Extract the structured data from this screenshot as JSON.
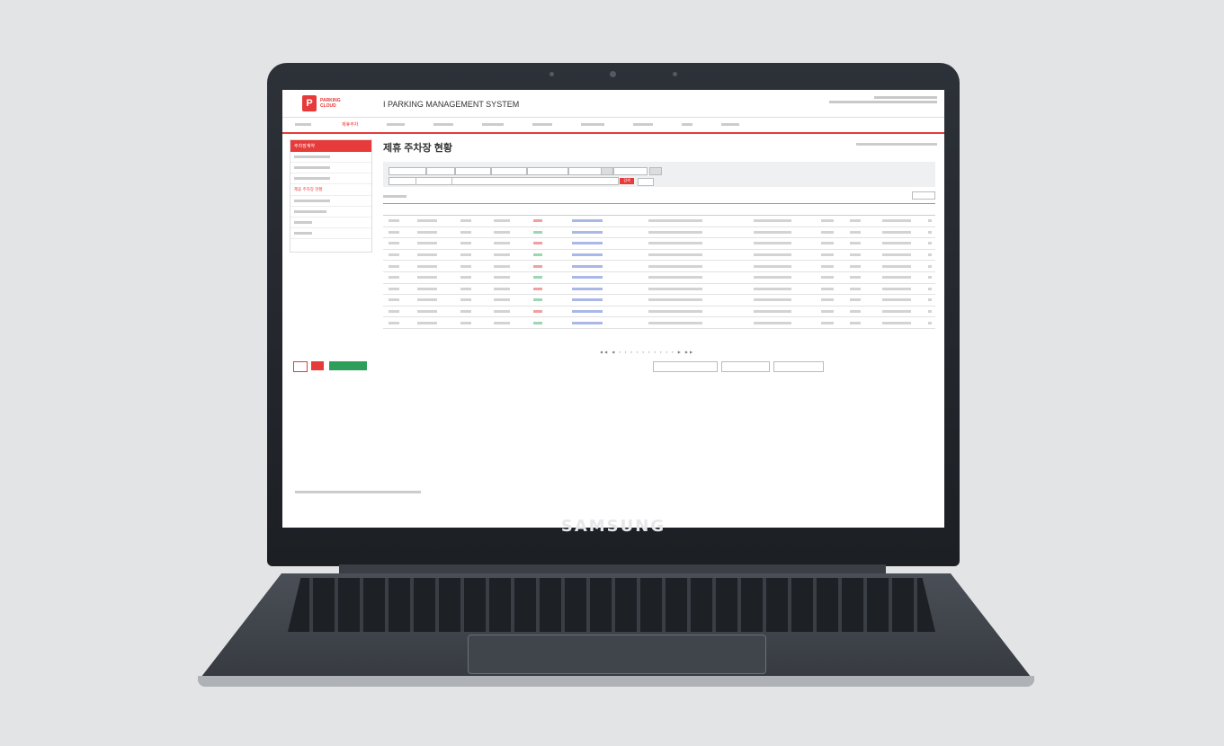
{
  "device": {
    "brand": "SAMSUNG"
  },
  "logo": {
    "mark": "P",
    "line1": "PARKING",
    "line2": "CLOUD"
  },
  "system_title": "I PARKING MANAGEMENT SYSTEM",
  "nav": [
    "주차계약",
    "제휴주차",
    "",
    "",
    "",
    "",
    "",
    "",
    "",
    ""
  ],
  "sidebar": {
    "title": "주차장계약",
    "items": [
      "",
      "",
      "",
      "제휴 주차장 현황",
      "",
      "",
      "",
      ""
    ]
  },
  "page": {
    "title": "제휴 주차장 현황"
  },
  "search": {
    "search_button": "검색"
  },
  "table": {
    "rows": [
      {
        "status_class": "red"
      },
      {
        "status_class": "green"
      },
      {
        "status_class": "red"
      },
      {
        "status_class": "green"
      },
      {
        "status_class": "red"
      },
      {
        "status_class": "green"
      },
      {
        "status_class": "red"
      },
      {
        "status_class": "green"
      },
      {
        "status_class": "red"
      },
      {
        "status_class": "green"
      }
    ]
  },
  "colors": {
    "accent": "#e73a3a",
    "green": "#2e9e5b",
    "link": "#3d5fc7"
  }
}
